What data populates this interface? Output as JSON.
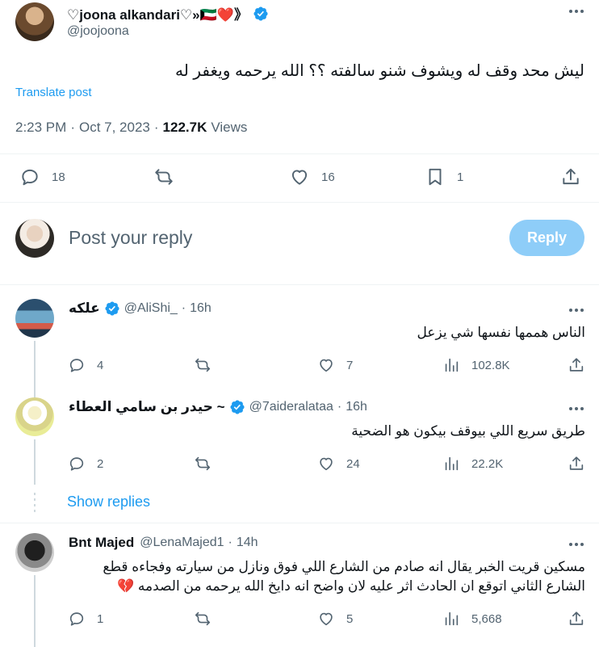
{
  "main_post": {
    "display_name": "♡joona alkandari♡»🇰🇼❤️》",
    "handle": "@joojoona",
    "text": "ليش محد وقف له ويشوف شنو سالفته ؟؟ الله يرحمه ويغفر له",
    "translate_label": "Translate post",
    "time": "2:23 PM",
    "date": "Oct 7, 2023",
    "views_count": "122.7K",
    "views_label": "Views",
    "replies": "18",
    "reposts": "",
    "likes": "16",
    "bookmarks": "1"
  },
  "composer": {
    "placeholder": "Post your reply",
    "reply_button": "Reply"
  },
  "replies": [
    {
      "display_name": "علكه",
      "handle": "@AliShi_",
      "time": "16h",
      "text": "الناس هممها نفسها شي يزعل",
      "replies": "4",
      "reposts": "",
      "likes": "7",
      "views": "102.8K"
    },
    {
      "display_name": "حيدر بن سامي العطاء ~",
      "handle": "@7aideralataa",
      "time": "16h",
      "text": "طريق سريع اللي بيوقف بيكون هو الضحية",
      "replies": "2",
      "reposts": "",
      "likes": "24",
      "views": "22.2K"
    },
    {
      "display_name": "Bnt Majed",
      "handle": "@LenaMajed1",
      "time": "14h",
      "text": "مسكين قريت الخبر يقال انه صادم من الشارع اللي فوق ونازل من سيارته وفجاءه قطع الشارع الثاني اتوقع ان الحادث اثر عليه لان واضح انه دايخ الله يرحمه من الصدمه 💔",
      "replies": "1",
      "reposts": "",
      "likes": "5",
      "views": "5,668"
    }
  ],
  "show_replies_label": "Show replies",
  "separator_dot": "·",
  "colors": {
    "accent": "#1d9bf0",
    "reply_button_disabled": "#8ecdf8",
    "text": "#0f1419",
    "muted": "#536471"
  }
}
